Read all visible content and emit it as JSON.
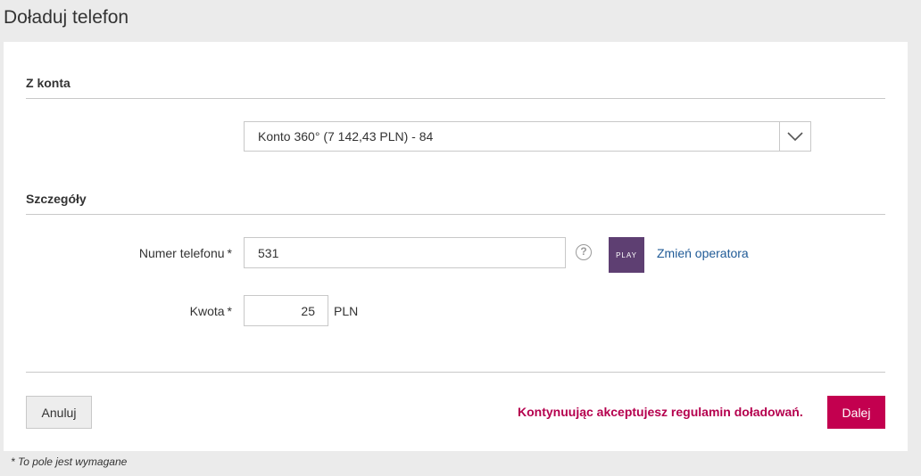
{
  "page": {
    "title": "Doładuj telefon"
  },
  "source": {
    "section_title": "Z konta",
    "account_selected": "Konto 360° (7 142,43 PLN) - 84"
  },
  "details": {
    "section_title": "Szczegóły",
    "phone": {
      "label": "Numer telefonu",
      "value": "531",
      "help_glyph": "?"
    },
    "operator": {
      "logo_text": "PLAY",
      "logo_color": "#5e3f72",
      "change_link": "Zmień operatora"
    },
    "amount": {
      "label": "Kwota",
      "value": "25",
      "currency": "PLN"
    },
    "required_marker": "*"
  },
  "actions": {
    "cancel_label": "Anuluj",
    "terms_text": "Kontynuując akceptujesz regulamin doładowań.",
    "next_label": "Dalej"
  },
  "footnote": "* To pole jest wymagane",
  "colors": {
    "accent": "#c3004f",
    "link": "#1f5a96"
  }
}
